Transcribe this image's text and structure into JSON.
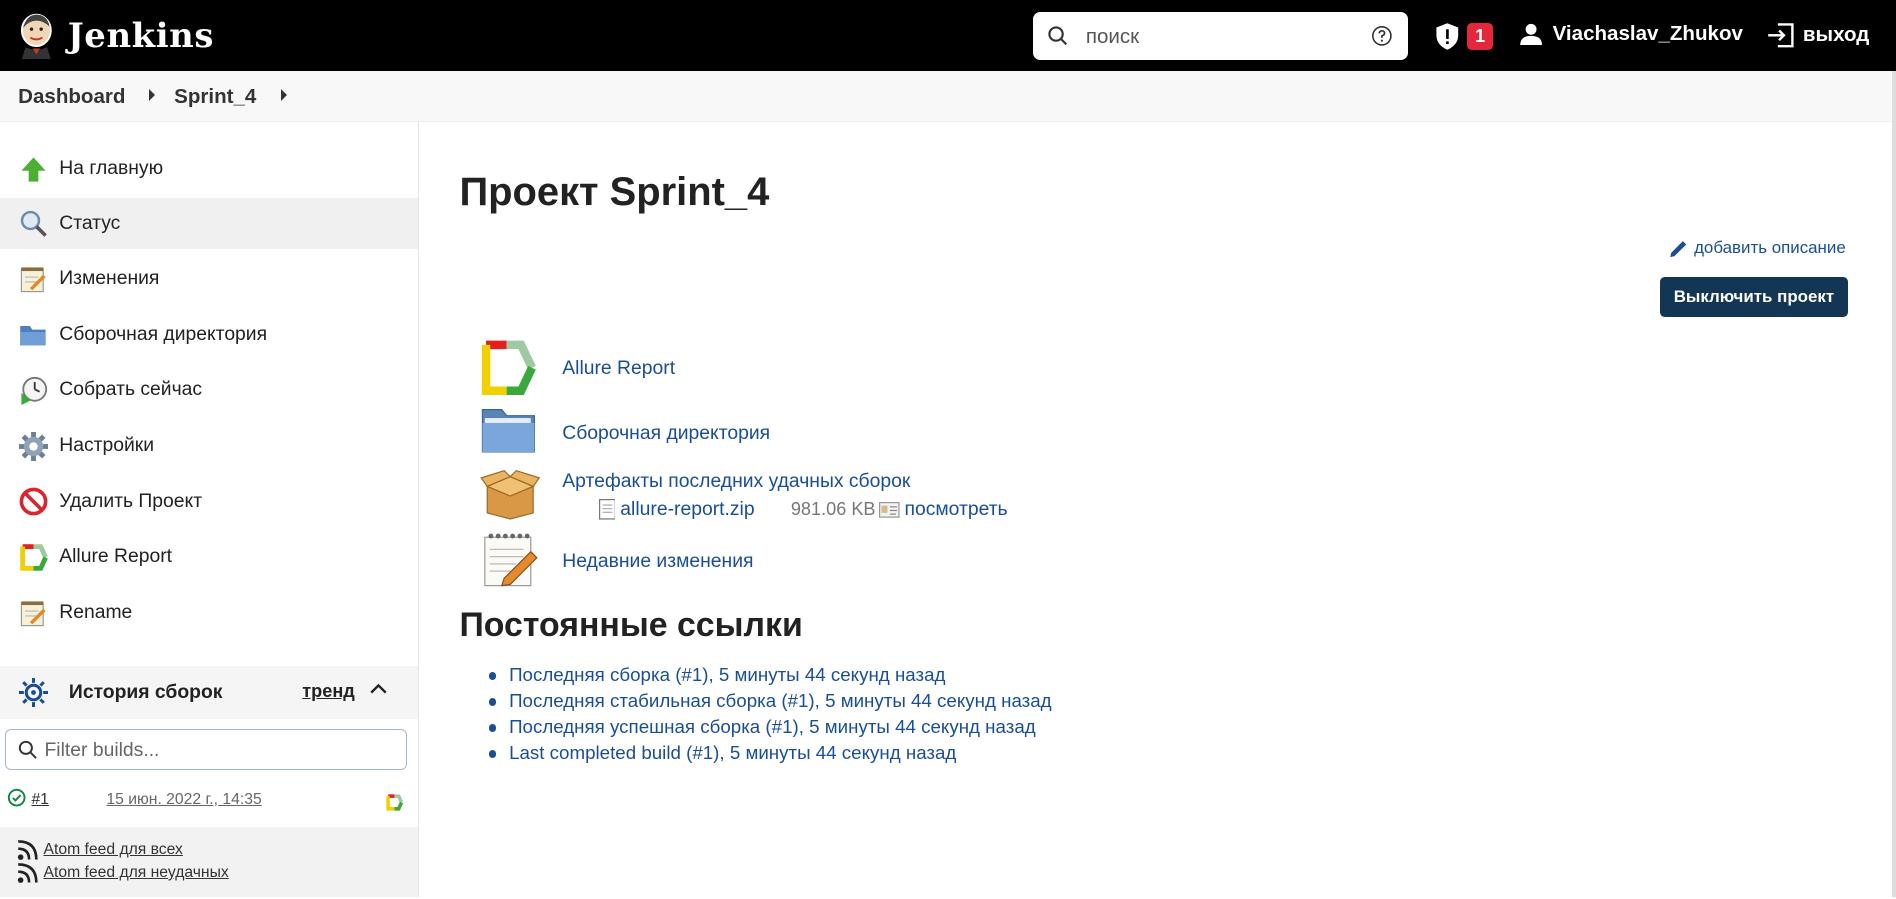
{
  "header": {
    "brand": "Jenkins",
    "search_placeholder": "поиск",
    "security_count": "1",
    "username": "Viachaslav_Zhukov",
    "logout_label": "выход"
  },
  "breadcrumb": {
    "items": [
      "Dashboard",
      "Sprint_4"
    ]
  },
  "sidebar": {
    "items": [
      {
        "label": "На главную",
        "icon": "arrow-up-icon"
      },
      {
        "label": "Статус",
        "icon": "search-icon"
      },
      {
        "label": "Изменения",
        "icon": "notepad-icon"
      },
      {
        "label": "Сборочная директория",
        "icon": "folder-icon"
      },
      {
        "label": "Собрать сейчас",
        "icon": "clock-build-icon"
      },
      {
        "label": "Настройки",
        "icon": "gear-icon"
      },
      {
        "label": "Удалить Проект",
        "icon": "no-entry-icon"
      },
      {
        "label": "Allure Report",
        "icon": "allure-icon"
      },
      {
        "label": "Rename",
        "icon": "notepad-icon"
      }
    ],
    "active_index": 1
  },
  "build_history": {
    "title": "История сборок",
    "trend_label": "тренд",
    "filter_placeholder": "Filter builds...",
    "builds": [
      {
        "number": "#1",
        "date": "15 июн. 2022 г., 14:35",
        "status": "success"
      }
    ],
    "feeds": [
      "Atom feed для всех",
      "Atom feed для неудачных"
    ]
  },
  "main": {
    "title": "Проект Sprint_4",
    "add_description": "добавить описание",
    "disable_button": "Выключить проект",
    "links": {
      "allure": "Allure Report",
      "workspace": "Сборочная директория",
      "artifacts": "Артефакты последних удачных сборок",
      "changes": "Недавние изменения"
    },
    "artifact": {
      "file": "allure-report.zip",
      "size": "981.06 KB",
      "view": "посмотреть"
    },
    "permalinks_title": "Постоянные ссылки",
    "permalinks": [
      "Последняя сборка (#1), 5 минуты 44 секунд назад",
      "Последняя стабильная сборка (#1), 5 минуты 44 секунд назад",
      "Последняя успешная сборка (#1), 5 минуты 44 секунд назад",
      "Last completed build (#1), 5 минуты 44 секунд назад"
    ]
  },
  "colors": {
    "header_bg": "#000000",
    "link": "#1a4e94",
    "primary_button": "#123654",
    "badge": "#e6263b"
  }
}
